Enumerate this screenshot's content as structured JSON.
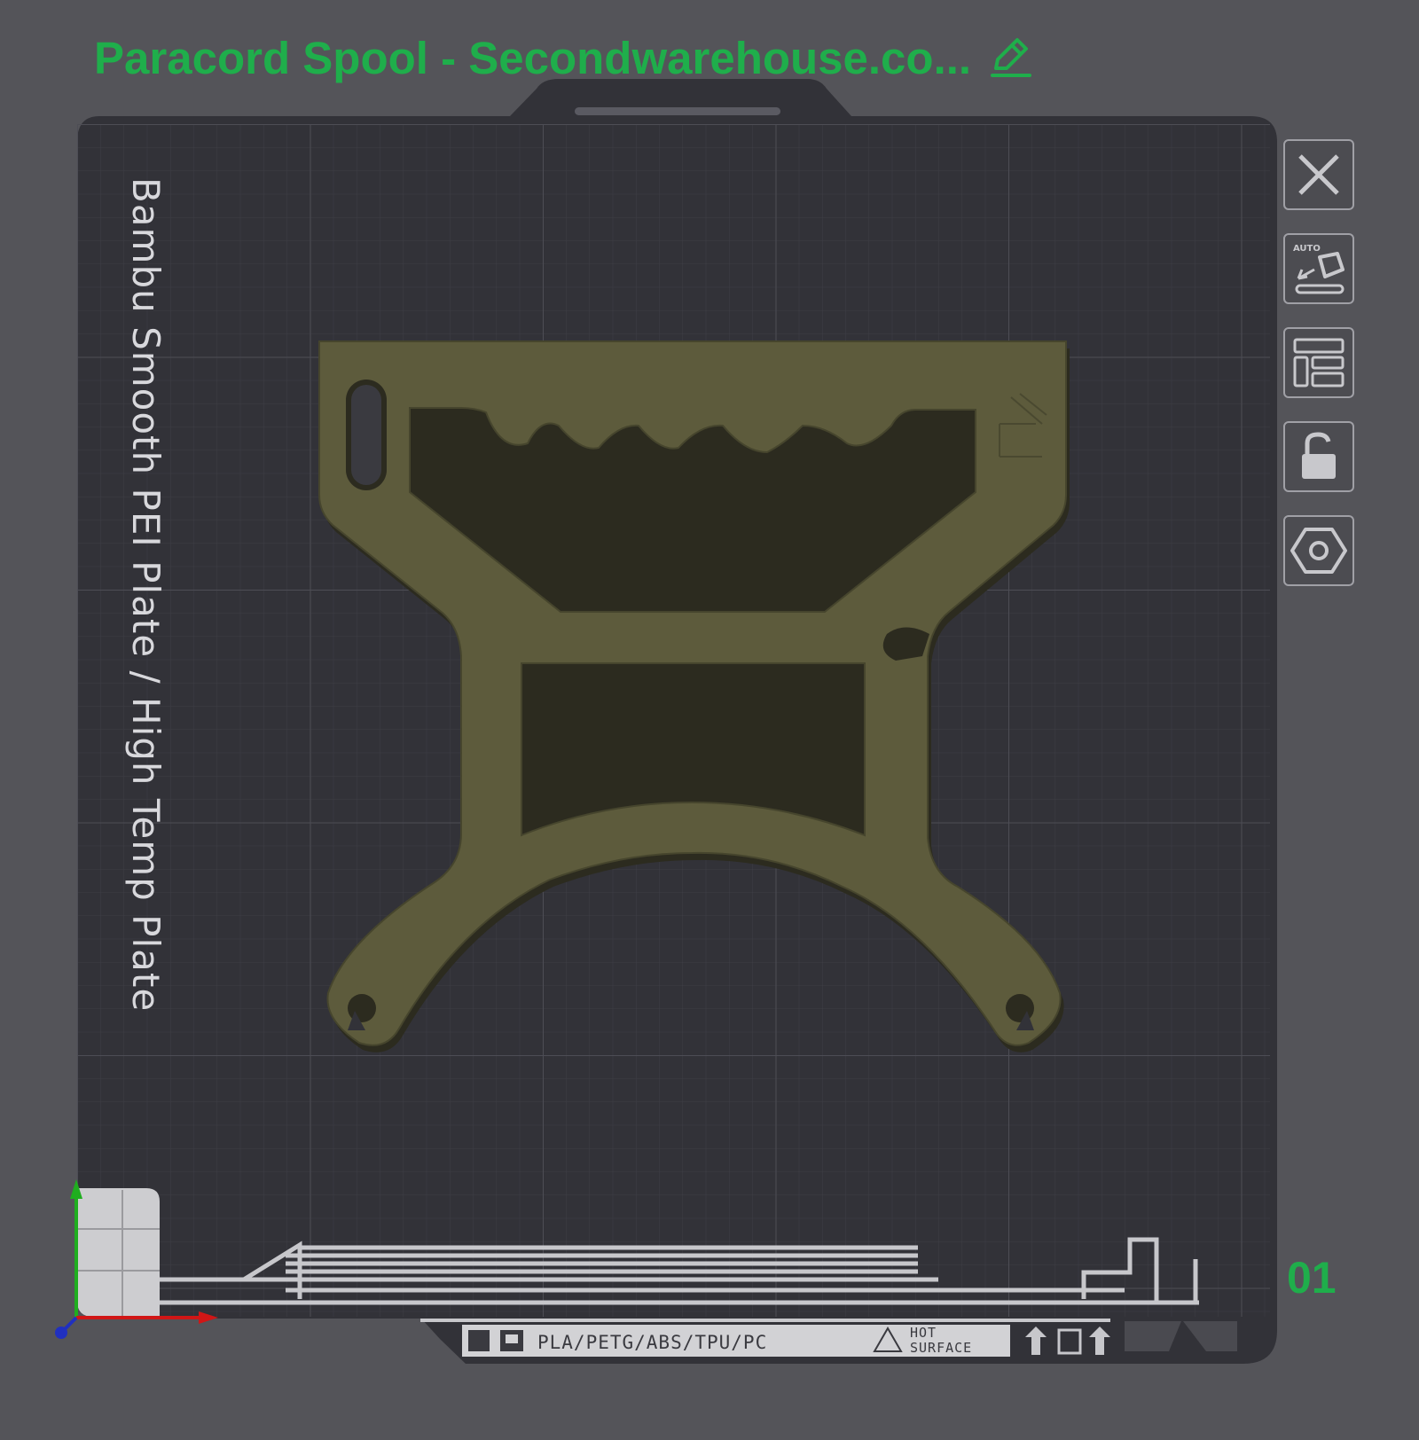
{
  "plate": {
    "title": "Paracord Spool - Secondwarehouse.co...",
    "index": "01",
    "plate_type": "Bambu Smooth PEI Plate / High Temp Plate",
    "materials": "PLA/PETG/ABS/TPU/PC",
    "hot_line1": "HOT",
    "hot_line2": "SURFACE"
  },
  "toolbar": {
    "close_icon": "close-icon",
    "auto_orient_label": "AUTO",
    "arrange_icon": "arrange-icon",
    "lock_icon": "unlock-icon",
    "settings_icon": "hexagon-settings-icon"
  },
  "colors": {
    "accent": "#1fae4b",
    "background": "#545459",
    "bed": "#323238",
    "model": "#5d5b3c"
  }
}
